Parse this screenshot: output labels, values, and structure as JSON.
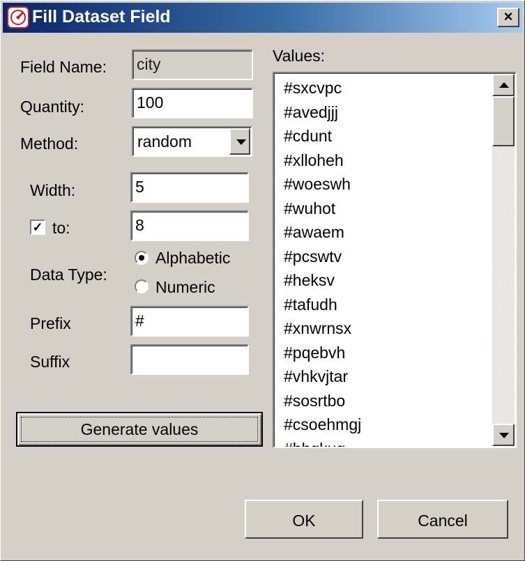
{
  "window": {
    "title": "Fill Dataset Field",
    "close_label": "×"
  },
  "form": {
    "field_name_label": "Field Name:",
    "field_name_value": "city",
    "quantity_label": "Quantity:",
    "quantity_value": "100",
    "method_label": "Method:",
    "method_value": "random",
    "width_label": "Width:",
    "width_value": "5",
    "to_checked": true,
    "to_label": "to:",
    "to_value": "8",
    "data_type_label": "Data Type:",
    "data_type_options": [
      {
        "label": "Alphabetic",
        "selected": true
      },
      {
        "label": "Numeric",
        "selected": false
      }
    ],
    "prefix_label": "Prefix",
    "prefix_value": "#",
    "suffix_label": "Suffix",
    "suffix_value": "",
    "generate_button": "Generate values"
  },
  "values": {
    "label": "Values:",
    "items": [
      "#sxcvpc",
      "#avedjjj",
      "#cdunt",
      "#xlloheh",
      "#woeswh",
      "#wuhot",
      "#awaem",
      "#pcswtv",
      "#heksv",
      "#tafudh",
      "#xnwrnsx",
      "#pqebvh",
      "#vhkvjtar",
      "#sosrtbo",
      "#csoehmgj",
      "#hhgkug"
    ]
  },
  "footer": {
    "ok_button": "OK",
    "cancel_button": "Cancel"
  }
}
